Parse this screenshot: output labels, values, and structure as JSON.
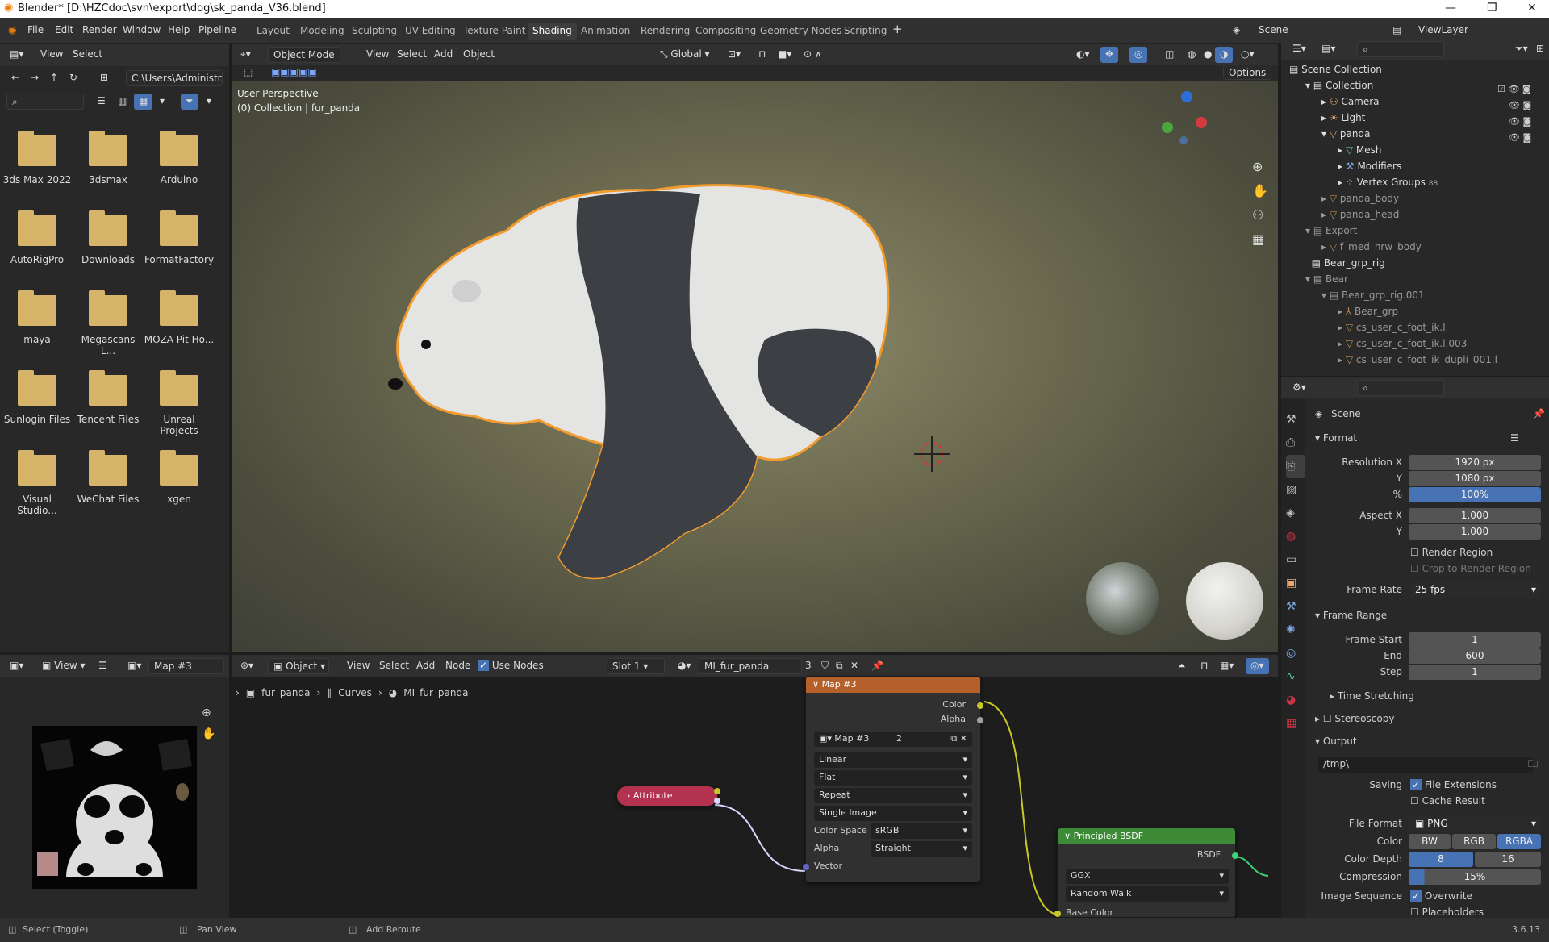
{
  "titlebar": {
    "title": "Blender* [D:\\HZCdoc\\svn\\export\\dog\\sk_panda_V36.blend]"
  },
  "menu": {
    "items": [
      "File",
      "Edit",
      "Render",
      "Window",
      "Help",
      "Pipeline"
    ]
  },
  "workspaces": [
    "Layout",
    "Modeling",
    "Sculpting",
    "UV Editing",
    "Texture Paint",
    "Shading",
    "Animation",
    "Rendering",
    "Compositing",
    "Geometry Nodes",
    "Scripting"
  ],
  "active_workspace": "Shading",
  "scene": {
    "label": "Scene",
    "viewlayer": "ViewLayer"
  },
  "filebrowser": {
    "menu": [
      "View",
      "Select"
    ],
    "path": "C:\\Users\\Administr...",
    "folders": [
      "3ds Max 2022",
      "3dsmax",
      "Arduino",
      "AutoRigPro",
      "Downloads",
      "FormatFactory",
      "maya",
      "Megascans L...",
      "MOZA Pit Ho...",
      "Sunlogin Files",
      "Tencent Files",
      "Unreal Projects",
      "Visual Studio...",
      "WeChat Files",
      "xgen"
    ]
  },
  "viewport": {
    "mode": "Object Mode",
    "menu": [
      "View",
      "Select",
      "Add",
      "Object"
    ],
    "orientation": "Global",
    "options": "Options",
    "overlay_title": "User Perspective",
    "overlay_sub": "(0) Collection | fur_panda"
  },
  "outliner": {
    "root": "Scene Collection",
    "items": [
      "Collection",
      "Camera",
      "Light",
      "panda",
      "Mesh",
      "Modifiers",
      "Vertex Groups",
      "panda_body",
      "panda_head",
      "Export",
      "f_med_nrw_body",
      "Bear_grp_rig",
      "Bear",
      "Bear_grp_rig.001",
      "Bear_grp",
      "cs_user_c_foot_ik.l",
      "cs_user_c_foot_ik.l.003",
      "cs_user_c_foot_ik_dupli_001.l"
    ],
    "vertex_groups_count": "88"
  },
  "properties": {
    "title": "Scene",
    "format": "Format",
    "resolution_x_label": "Resolution X",
    "resolution_x": "1920 px",
    "y_label": "Y",
    "resolution_y": "1080 px",
    "pct_label": "%",
    "pct": "100%",
    "aspect_x_label": "Aspect X",
    "aspect_x": "1.000",
    "aspect_y": "1.000",
    "render_region": "Render Region",
    "crop": "Crop to Render Region",
    "frame_rate_label": "Frame Rate",
    "frame_rate": "25 fps",
    "frame_range": "Frame Range",
    "frame_start_label": "Frame Start",
    "frame_start": "1",
    "end_label": "End",
    "end": "600",
    "step_label": "Step",
    "step": "1",
    "time_stretching": "Time Stretching",
    "stereoscopy": "Stereoscopy",
    "output": "Output",
    "output_path": "/tmp\\",
    "saving_label": "Saving",
    "file_ext": "File Extensions",
    "cache": "Cache Result",
    "file_format_label": "File Format",
    "file_format": "PNG",
    "color_label": "Color",
    "color_opts": [
      "BW",
      "RGB",
      "RGBA"
    ],
    "color_depth_label": "Color Depth",
    "depth_opts": [
      "8",
      "16"
    ],
    "compression_label": "Compression",
    "compression": "15%",
    "image_seq_label": "Image Sequence",
    "overwrite": "Overwrite",
    "placeholders": "Placeholders"
  },
  "image_editor": {
    "menu": "View",
    "image": "Map #3"
  },
  "node_editor": {
    "object": "Object",
    "menu": [
      "View",
      "Select",
      "Add",
      "Node"
    ],
    "use_nodes": "Use Nodes",
    "slot": "Slot 1",
    "material": "MI_fur_panda",
    "users": "3",
    "breadcrumb": [
      "fur_panda",
      "Curves",
      "MI_fur_panda"
    ],
    "map_node": {
      "title": "Map #3",
      "out_color": "Color",
      "out_alpha": "Alpha",
      "image": "Map #3",
      "users": "2",
      "interp": "Linear",
      "proj": "Flat",
      "ext": "Repeat",
      "source": "Single Image",
      "cs_label": "Color Space",
      "cs": "sRGB",
      "alpha_label": "Alpha",
      "alpha": "Straight",
      "in_vector": "Vector"
    },
    "attr_node": {
      "title": "Attribute"
    },
    "bsdf_node": {
      "title": "Principled BSDF",
      "out": "BSDF",
      "dist": "GGX",
      "sss": "Random Walk",
      "in_base": "Base Color"
    }
  },
  "status": {
    "select": "Select (Toggle)",
    "pan": "Pan View",
    "reroute": "Add Reroute",
    "version": "3.6.13"
  },
  "colors": {
    "accent": "#4772b3",
    "node_image": "#b5602a",
    "node_attr": "#b3324f",
    "node_bsdf": "#3d8a37",
    "outline": "#f29b2e"
  }
}
